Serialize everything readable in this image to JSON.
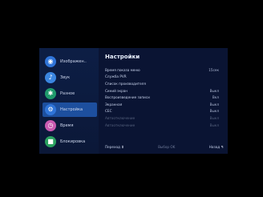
{
  "sidebar": {
    "items": [
      {
        "label": "Изображен..",
        "icon": "image-icon",
        "color": "#2f74d8"
      },
      {
        "label": "Звук",
        "icon": "sound-icon",
        "color": "#3b86e0"
      },
      {
        "label": "Разное",
        "icon": "palm-icon",
        "color": "#1f9a6c"
      },
      {
        "label": "Настройка",
        "icon": "settings-icon",
        "color": "#2f74d8"
      },
      {
        "label": "Время",
        "icon": "time-icon",
        "color": "#c95ab0"
      },
      {
        "label": "Блокировка",
        "icon": "lock-icon",
        "color": "#2aa160"
      }
    ]
  },
  "main": {
    "title": "Настройки",
    "rows": [
      {
        "label": "Время показа меню",
        "value": "15сек",
        "enabled": true
      },
      {
        "label": "Служба PVR",
        "value": "",
        "enabled": true
      },
      {
        "label": "Список производителя",
        "value": "",
        "enabled": true
      },
      {
        "label": "Синий экран",
        "value": "Выкл",
        "enabled": true
      },
      {
        "label": "Воспроизведение записи",
        "value": "Вкл",
        "enabled": true
      },
      {
        "label": "Экранная",
        "value": "Выкл",
        "enabled": true
      },
      {
        "label": "CEC",
        "value": "Выкл",
        "enabled": true
      },
      {
        "label": "Автоотключение",
        "value": "Выкл",
        "enabled": false
      },
      {
        "label": "Автоотключение",
        "value": "Выкл",
        "enabled": false
      }
    ]
  },
  "footer": {
    "move_label": "Переход",
    "move_key": "⇕",
    "select_label": "Выбор",
    "select_key": "OK",
    "back_label": "Назад",
    "back_key": "↰"
  },
  "colors": {
    "accent": "#1d4f9e",
    "panel": "#0a1433"
  }
}
